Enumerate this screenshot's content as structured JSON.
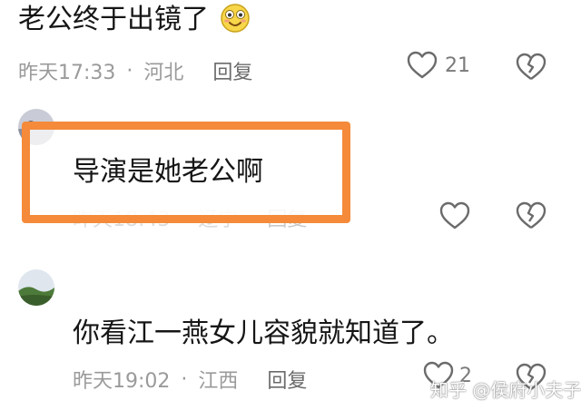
{
  "comments": [
    {
      "text": "老公终于出镜了",
      "emoji": "smile-face-emoji",
      "time": "昨天17:33",
      "location": "河北",
      "reply_label": "回复",
      "like_count": "21"
    },
    {
      "username": "·",
      "text": "导演是她老公啊",
      "time": "昨天18:43",
      "location": "辽宁",
      "reply_label": "回复",
      "like_count": ""
    },
    {
      "text": "你看江一燕女儿容貌就知道了。",
      "time": "昨天19:02",
      "location": "江西",
      "reply_label": "回复",
      "like_count": "2"
    }
  ],
  "separator": "·",
  "watermark": "知乎 @侯府小夫子",
  "colors": {
    "highlight_border": "#f48a3a",
    "meta_text": "#9a9a9a"
  }
}
